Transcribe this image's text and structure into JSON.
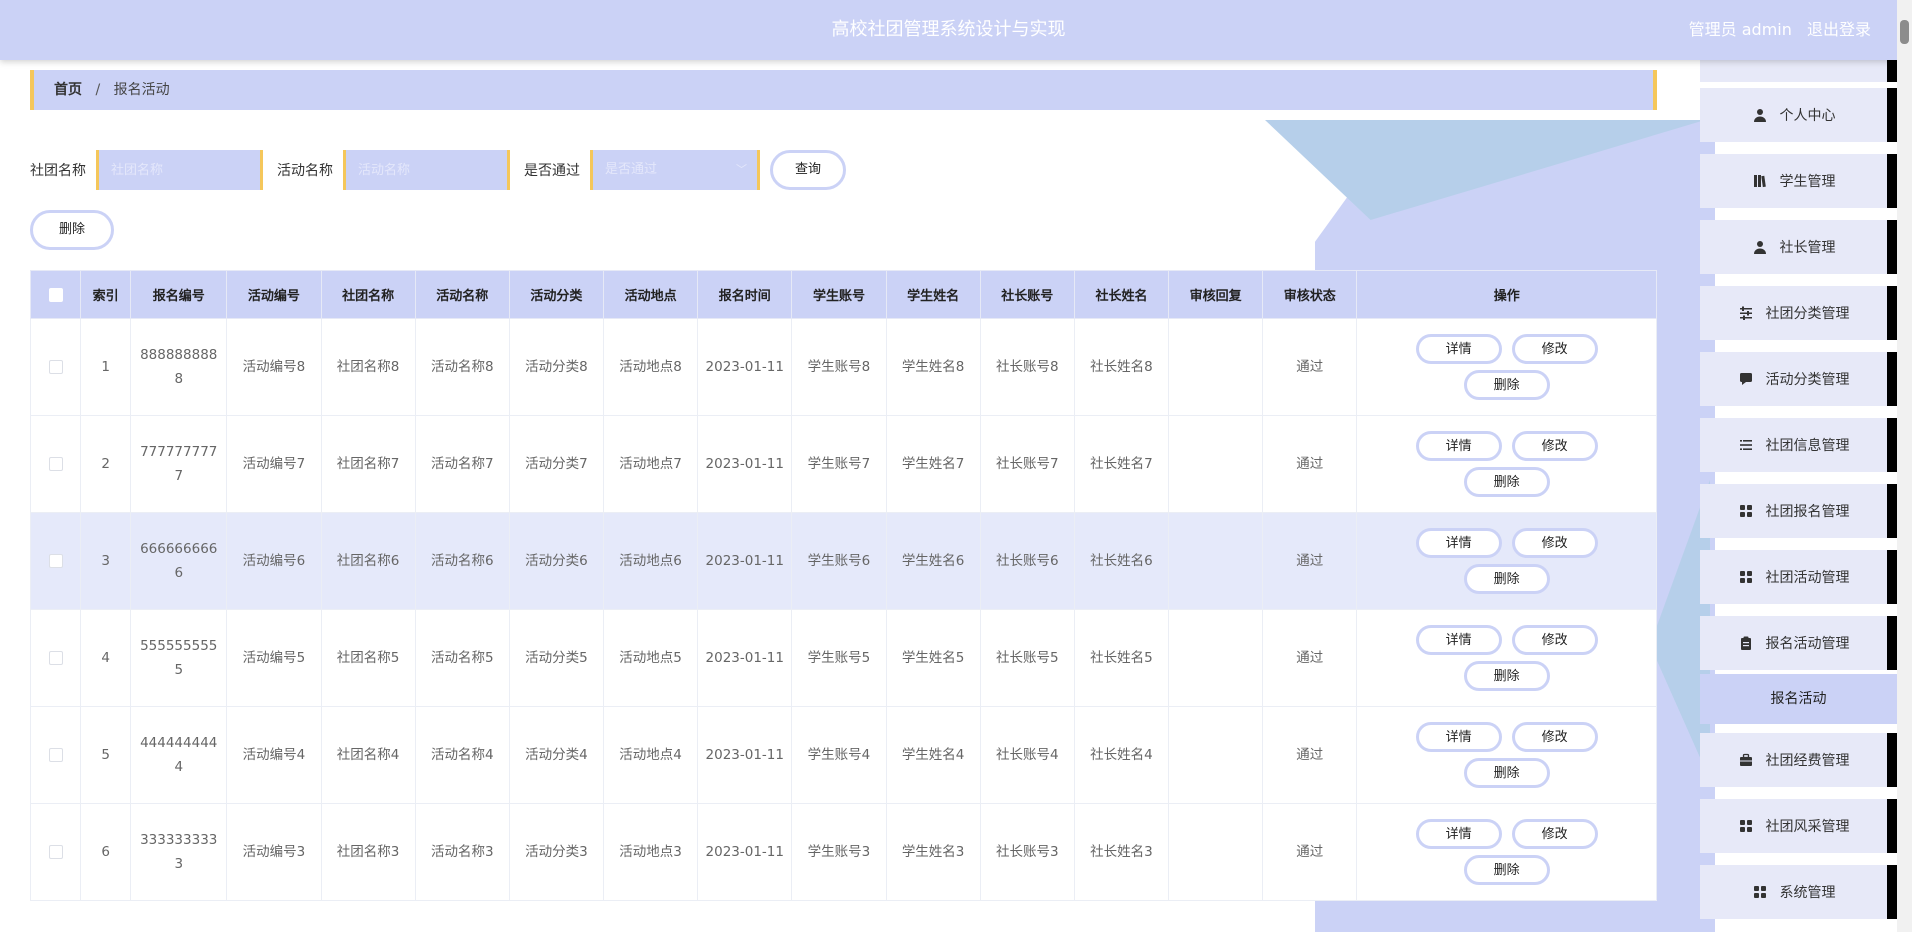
{
  "header": {
    "title": "高校社团管理系统设计与实现",
    "user_label": "管理员 admin",
    "logout_label": "退出登录"
  },
  "breadcrumb": {
    "home": "首页",
    "separator": "/",
    "current": "报名活动"
  },
  "search": {
    "club_label": "社团名称",
    "club_placeholder": "社团名称",
    "activity_label": "活动名称",
    "activity_placeholder": "活动名称",
    "pass_label": "是否通过",
    "pass_placeholder": "是否通过",
    "query_button": "查询"
  },
  "delete_button": "删除",
  "table": {
    "columns": [
      "索引",
      "报名编号",
      "活动编号",
      "社团名称",
      "活动名称",
      "活动分类",
      "活动地点",
      "报名时间",
      "学生账号",
      "学生姓名",
      "社长账号",
      "社长姓名",
      "审核回复",
      "审核状态",
      "操作"
    ],
    "action_labels": {
      "detail": "详情",
      "edit": "修改",
      "delete": "删除"
    },
    "rows": [
      {
        "index": "1",
        "reg_no": "8888888888",
        "act_no": "活动编号8",
        "club": "社团名称8",
        "act_name": "活动名称8",
        "category": "活动分类8",
        "place": "活动地点8",
        "time": "2023-01-11",
        "stu_acc": "学生账号8",
        "stu_name": "学生姓名8",
        "leader_acc": "社长账号8",
        "leader_name": "社长姓名8",
        "reply": "",
        "status": "通过"
      },
      {
        "index": "2",
        "reg_no": "7777777777",
        "act_no": "活动编号7",
        "club": "社团名称7",
        "act_name": "活动名称7",
        "category": "活动分类7",
        "place": "活动地点7",
        "time": "2023-01-11",
        "stu_acc": "学生账号7",
        "stu_name": "学生姓名7",
        "leader_acc": "社长账号7",
        "leader_name": "社长姓名7",
        "reply": "",
        "status": "通过"
      },
      {
        "index": "3",
        "reg_no": "6666666666",
        "act_no": "活动编号6",
        "club": "社团名称6",
        "act_name": "活动名称6",
        "category": "活动分类6",
        "place": "活动地点6",
        "time": "2023-01-11",
        "stu_acc": "学生账号6",
        "stu_name": "学生姓名6",
        "leader_acc": "社长账号6",
        "leader_name": "社长姓名6",
        "reply": "",
        "status": "通过"
      },
      {
        "index": "4",
        "reg_no": "5555555555",
        "act_no": "活动编号5",
        "club": "社团名称5",
        "act_name": "活动名称5",
        "category": "活动分类5",
        "place": "活动地点5",
        "time": "2023-01-11",
        "stu_acc": "学生账号5",
        "stu_name": "学生姓名5",
        "leader_acc": "社长账号5",
        "leader_name": "社长姓名5",
        "reply": "",
        "status": "通过"
      },
      {
        "index": "5",
        "reg_no": "4444444444",
        "act_no": "活动编号4",
        "club": "社团名称4",
        "act_name": "活动名称4",
        "category": "活动分类4",
        "place": "活动地点4",
        "time": "2023-01-11",
        "stu_acc": "学生账号4",
        "stu_name": "学生姓名4",
        "leader_acc": "社长账号4",
        "leader_name": "社长姓名4",
        "reply": "",
        "status": "通过"
      },
      {
        "index": "6",
        "reg_no": "3333333333",
        "act_no": "活动编号3",
        "club": "社团名称3",
        "act_name": "活动名称3",
        "category": "活动分类3",
        "place": "活动地点3",
        "time": "2023-01-11",
        "stu_acc": "学生账号3",
        "stu_name": "学生姓名3",
        "leader_acc": "社长账号3",
        "leader_name": "社长姓名3",
        "reply": "",
        "status": "通过"
      }
    ]
  },
  "sidebar": {
    "items": [
      {
        "label": "个人中心",
        "icon": "user-icon"
      },
      {
        "label": "学生管理",
        "icon": "book-icon"
      },
      {
        "label": "社长管理",
        "icon": "user-icon"
      },
      {
        "label": "社团分类管理",
        "icon": "sliders-icon"
      },
      {
        "label": "活动分类管理",
        "icon": "chat-icon"
      },
      {
        "label": "社团信息管理",
        "icon": "list-icon"
      },
      {
        "label": "社团报名管理",
        "icon": "grid-icon"
      },
      {
        "label": "社团活动管理",
        "icon": "grid-icon"
      },
      {
        "label": "报名活动管理",
        "icon": "clipboard-icon"
      },
      {
        "label": "报名活动",
        "icon": ""
      },
      {
        "label": "社团经费管理",
        "icon": "briefcase-icon"
      },
      {
        "label": "社团风采管理",
        "icon": "grid-icon"
      },
      {
        "label": "系统管理",
        "icon": "grid-icon"
      }
    ]
  },
  "colors": {
    "accent": "#cbd2f6",
    "border_accent": "#f5c75b",
    "highlight_row": "#e5e9fa",
    "decoration_blue": "#b6cfea"
  }
}
